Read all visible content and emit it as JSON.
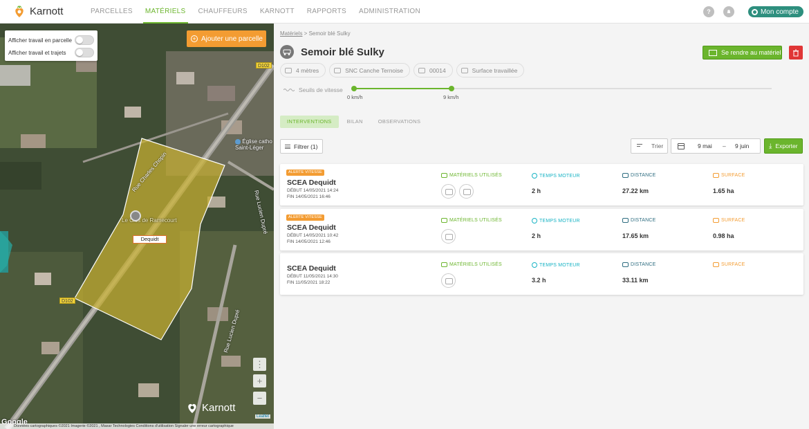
{
  "brand": {
    "name": "Karnott"
  },
  "nav": [
    {
      "label": "PARCELLES",
      "active": false
    },
    {
      "label": "MATÉRIELS",
      "active": true
    },
    {
      "label": "CHAUFFEURS",
      "active": false
    },
    {
      "label": "KARNOTT",
      "active": false
    },
    {
      "label": "RAPPORTS",
      "active": false
    },
    {
      "label": "ADMINISTRATION",
      "active": false
    }
  ],
  "topbar": {
    "help": "?",
    "account_label": "Mon compte"
  },
  "map": {
    "toggle_parcel": "Afficher travail en parcelle",
    "toggle_trips": "Afficher travail et trajets",
    "add_parcel": "Ajouter une parcelle",
    "road_tags": [
      "D102",
      "D102"
    ],
    "streets": [
      "Rue Charles Chopin",
      "Rue Lucien Dupré",
      "Rue Lucien Dupré",
      "Église catho Saint-Léger",
      "Le Clos de Ramecourt"
    ],
    "parcel_label": "Dequidt",
    "watermark": "Karnott",
    "google": "Google",
    "leaflet": "Leaflet",
    "footer": "Données cartographiques ©2021 Imagerie ©2021 , Maxar Technologies   Conditions d'utilisation   Signaler une erreur cartographique",
    "controls": [
      "⋮",
      "+",
      "−"
    ]
  },
  "panel": {
    "breadcrumb_link": "Matériels",
    "breadcrumb_rest": " > Semoir blé Sulky",
    "title": "Semoir blé Sulky",
    "go_button": "Se rendre au matériel",
    "chips": [
      "4 mètres",
      "SNC Canche Ternoise",
      "00014",
      "Surface travaillée"
    ],
    "speed_label": "Seuils de vitesse",
    "speed_min": "0 km/h",
    "speed_max": "9 km/h",
    "tabs": [
      {
        "label": "INTERVENTIONS",
        "active": true
      },
      {
        "label": "BILAN",
        "active": false
      },
      {
        "label": "OBSERVATIONS",
        "active": false
      }
    ],
    "filter": "Filtrer (1)",
    "sort": "Trier",
    "date_from": "9 mai",
    "date_sep": "–",
    "date_to": "9 juin",
    "export": "Exporter",
    "col_heads": {
      "materials": "MATÉRIELS UTILISÉS",
      "engine": "TEMPS MOTEUR",
      "distance": "DISTANCE",
      "surface": "SURFACE"
    },
    "interventions": [
      {
        "alert": "ALERTE VITESSE",
        "name": "SCEA Dequidt",
        "start": "DÉBUT 14/05/2021 14:24",
        "end": "FIN 14/05/2021 16:46",
        "engine": "2 h",
        "distance": "27.22 km",
        "surface": "1.65 ha"
      },
      {
        "alert": "ALERTE VITESSE",
        "name": "SCEA Dequidt",
        "start": "DÉBUT 14/05/2021 10:42",
        "end": "FIN 14/05/2021 12:46",
        "engine": "2 h",
        "distance": "17.65 km",
        "surface": "0.98 ha"
      },
      {
        "alert": "",
        "name": "SCEA Dequidt",
        "start": "DÉBUT 11/05/2021 14:30",
        "end": "FIN 11/05/2021 18:22",
        "engine": "3.2 h",
        "distance": "33.11 km",
        "surface": ""
      }
    ]
  },
  "colors": {
    "green": "#6bb52d",
    "orange": "#f39c32",
    "teal": "#2e8f7e",
    "red": "#e03636"
  }
}
